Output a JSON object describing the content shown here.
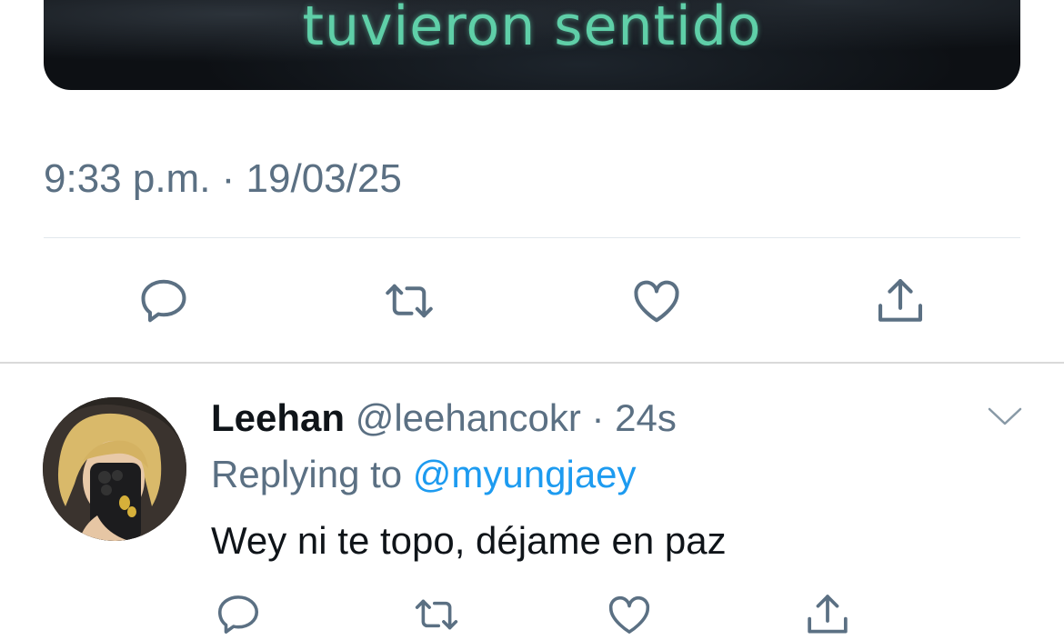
{
  "main_tweet": {
    "media_caption": "tuvieron sentido",
    "timestamp": "9:33 p.m. · 19/03/25",
    "actions": [
      "reply-icon",
      "retweet-icon",
      "like-icon",
      "share-icon"
    ]
  },
  "reply": {
    "display_name": "Leehan",
    "handle": "@leehancokr",
    "separator": "·",
    "time_ago": "24s",
    "replying_prefix": "Replying to",
    "replying_to": "@myungjaey",
    "text": "Wey ni te topo, déjame en paz",
    "actions": [
      "reply-icon",
      "retweet-icon",
      "like-icon",
      "share-icon"
    ]
  },
  "colors": {
    "secondary_text": "#5b7083",
    "mention_blue": "#1d9bf0",
    "primary_text": "#0f1419",
    "caption_green": "#5fcfa8"
  }
}
